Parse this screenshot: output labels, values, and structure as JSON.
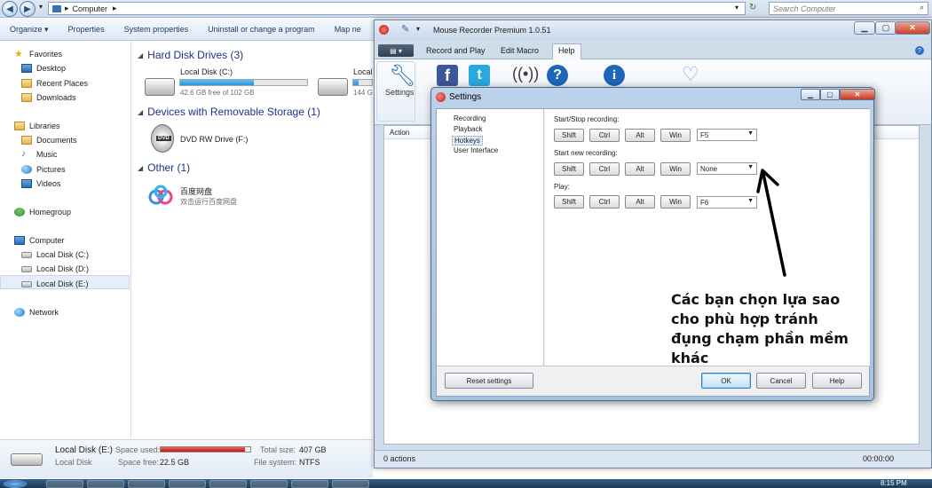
{
  "explorer": {
    "address": "Computer",
    "search_placeholder": "Search Computer",
    "commands": [
      "Organize ▾",
      "Properties",
      "System properties",
      "Uninstall or change a program",
      "Map ne"
    ],
    "nav": {
      "favorites": "Favorites",
      "desktop": "Desktop",
      "recent_places": "Recent Places",
      "downloads": "Downloads",
      "libraries": "Libraries",
      "documents": "Documents",
      "music": "Music",
      "pictures": "Pictures",
      "videos": "Videos",
      "homegroup": "Homegroup",
      "computer": "Computer",
      "local_c": "Local Disk (C:)",
      "local_d": "Local Disk (D:)",
      "local_e": "Local Disk (E:)",
      "network": "Network"
    },
    "groups": {
      "hdd": "Hard Disk Drives (3)",
      "removable": "Devices with Removable Storage (1)",
      "other": "Other (1)"
    },
    "drives": {
      "c_name": "Local Disk (C:)",
      "c_free": "42.6 GB free of 102 GB",
      "c_used_fraction": 0.58,
      "d_name": "Local",
      "d_free": "144 G",
      "d_used_fraction": 0.3,
      "dvd_name": "DVD RW Drive (F:)",
      "dvd_badge": "DVD",
      "other_name": "百度网盘",
      "other_sub": "双击运行百度网盘"
    },
    "details": {
      "name": "Local Disk (E:)",
      "type": "Local Disk",
      "space_used_label": "Space used:",
      "space_free_label": "Space free:",
      "space_free": "22.5 GB",
      "total_label": "Total size:",
      "total": "407 GB",
      "fs_label": "File system:",
      "fs": "NTFS",
      "used_fraction": 0.94
    },
    "clock": "8:15 PM"
  },
  "recorder": {
    "title": "Mouse Recorder Premium 1.0.51",
    "tabs": [
      "Record and Play",
      "Edit Macro",
      "Help"
    ],
    "settings_button": "Settings",
    "list_header": "Action",
    "status_left": "0 actions",
    "status_right": "00:00:00"
  },
  "settings": {
    "title": "Settings",
    "tree": [
      "Recording",
      "Playback",
      "Hotkeys",
      "User Interface"
    ],
    "hotkeys": [
      {
        "label": "Start/Stop recording:",
        "key": "F5"
      },
      {
        "label": "Start new recording:",
        "key": "None"
      },
      {
        "label": "Play:",
        "key": "F6"
      }
    ],
    "modifiers": [
      "Shift",
      "Ctrl",
      "Alt",
      "Win"
    ],
    "buttons": {
      "reset": "Reset settings",
      "ok": "OK",
      "cancel": "Cancel",
      "help": "Help"
    }
  },
  "annotation": "Các bạn chọn lựa sao cho phù hợp tránh đụng chạm phần mềm khác",
  "colors": {
    "accent": "#1e3287",
    "drive_fill": "#2b94d4",
    "used_bar": "#d01010",
    "close_red": "#c8412a"
  }
}
